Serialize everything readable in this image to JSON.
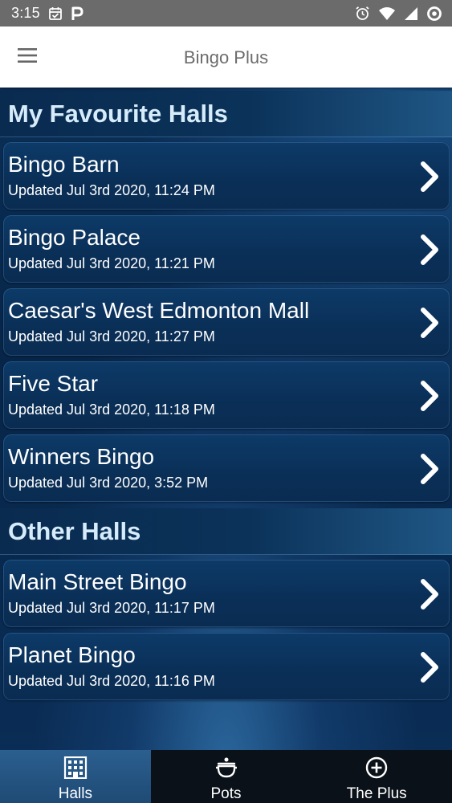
{
  "status_bar": {
    "time": "3:15",
    "icons": [
      "calendar-check-icon",
      "parking-p-icon",
      "alarm-icon",
      "wifi-icon",
      "cell-signal-icon",
      "data-saver-icon"
    ]
  },
  "app_bar": {
    "title": "Bingo Plus",
    "menu_icon": "hamburger-menu-icon"
  },
  "sections": [
    {
      "title": "My Favourite Halls",
      "halls": [
        {
          "name": "Bingo Barn",
          "updated": "Updated Jul 3rd 2020, 11:24 PM"
        },
        {
          "name": "Bingo Palace",
          "updated": "Updated Jul 3rd 2020, 11:21 PM"
        },
        {
          "name": "Caesar's West Edmonton Mall",
          "updated": "Updated Jul 3rd 2020, 11:27 PM"
        },
        {
          "name": "Five Star",
          "updated": "Updated Jul 3rd 2020, 11:18 PM"
        },
        {
          "name": "Winners Bingo",
          "updated": "Updated Jul 3rd 2020, 3:52 PM"
        }
      ]
    },
    {
      "title": "Other Halls",
      "halls": [
        {
          "name": "Main Street Bingo",
          "updated": "Updated Jul 3rd 2020, 11:17 PM"
        },
        {
          "name": "Planet Bingo",
          "updated": "Updated Jul 3rd 2020, 11:16 PM"
        }
      ]
    }
  ],
  "bottom_nav": {
    "items": [
      {
        "label": "Halls",
        "icon": "building-icon",
        "active": true
      },
      {
        "label": "Pots",
        "icon": "pot-icon",
        "active": false
      },
      {
        "label": "The Plus",
        "icon": "plus-circle-icon",
        "active": false
      }
    ]
  },
  "colors": {
    "status_bar": "#6b6b6b",
    "app_bar": "#ffffff",
    "title_text": "#6c6c6c",
    "section_title": "#d6ecfb",
    "background": "#072548",
    "nav_active": "#2b5f8f",
    "nav_background": "#0a1119"
  }
}
